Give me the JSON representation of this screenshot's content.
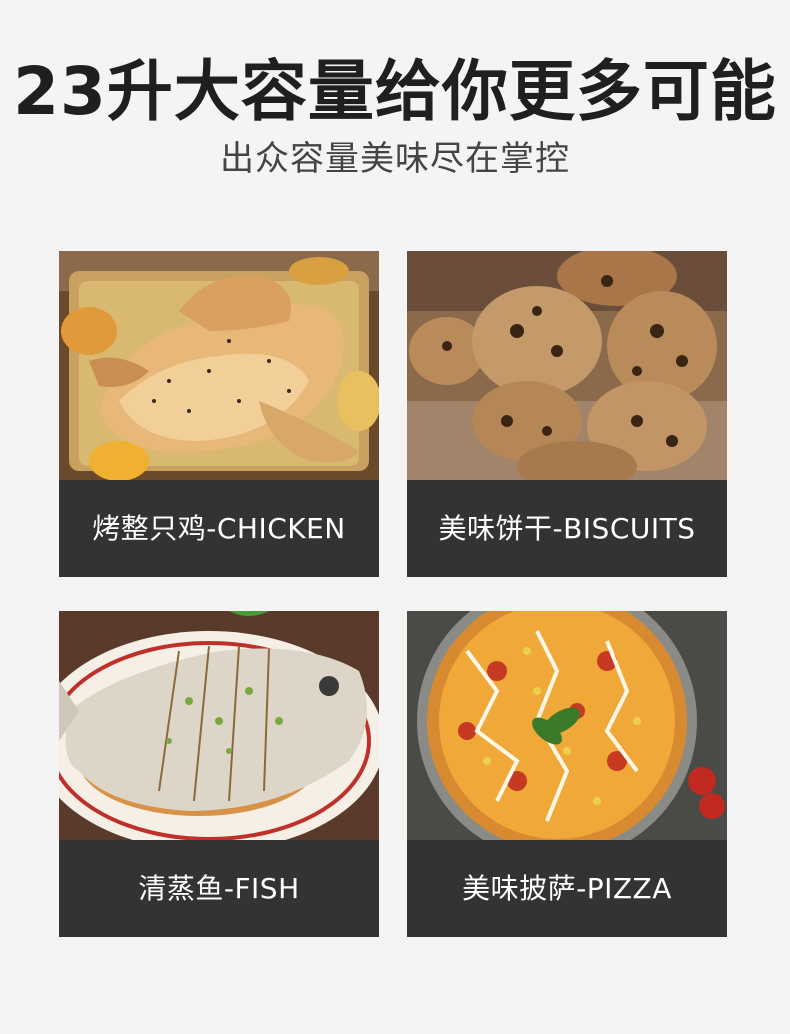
{
  "header": {
    "title": "23升大容量给你更多可能",
    "subtitle": "出众容量美味尽在掌控"
  },
  "cards": [
    {
      "caption": "烤整只鸡-CHICKEN",
      "photo": "roast-chicken-photo"
    },
    {
      "caption": "美味饼干-BISCUITS",
      "photo": "cookies-photo"
    },
    {
      "caption": "清蒸鱼-FISH",
      "photo": "steamed-fish-photo"
    },
    {
      "caption": "美味披萨-PIZZA",
      "photo": "pizza-photo"
    }
  ],
  "colors": {
    "background": "#f4f4f4",
    "caption_bar": "#333333",
    "title_text": "#1f1f1f"
  }
}
